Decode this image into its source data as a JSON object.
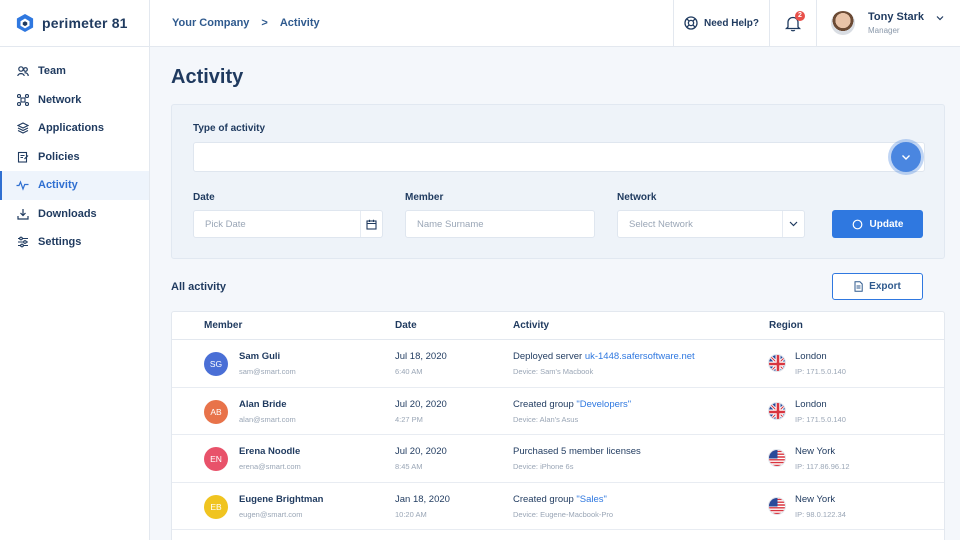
{
  "app": {
    "logo_text": "perimeter 81"
  },
  "sidebar": {
    "items": [
      {
        "label": "Team",
        "icon": "team-icon",
        "active": false
      },
      {
        "label": "Network",
        "icon": "network-icon",
        "active": false
      },
      {
        "label": "Applications",
        "icon": "applications-icon",
        "active": false
      },
      {
        "label": "Policies",
        "icon": "policies-icon",
        "active": false
      },
      {
        "label": "Activity",
        "icon": "activity-icon",
        "active": true
      },
      {
        "label": "Downloads",
        "icon": "downloads-icon",
        "active": false
      },
      {
        "label": "Settings",
        "icon": "settings-icon",
        "active": false
      }
    ]
  },
  "header": {
    "breadcrumb": [
      "Your Company",
      "Activity"
    ],
    "breadcrumb_separator": ">",
    "help_label": "Need Help?",
    "notification_count": "2",
    "user_name": "Tony Stark",
    "user_role": "Manager"
  },
  "page": {
    "title": "Activity"
  },
  "filters": {
    "type_label": "Type of activity",
    "type_value": "",
    "date_label": "Date",
    "date_placeholder": "Pick Date",
    "member_label": "Member",
    "member_placeholder": "Name Surname",
    "network_label": "Network",
    "network_placeholder": "Select Network",
    "update_label": "Update"
  },
  "activity": {
    "section_title": "All activity",
    "export_label": "Export",
    "columns": [
      "Member",
      "Date",
      "Activity",
      "Region"
    ],
    "rows": [
      {
        "initials": "SG",
        "avatar_color": "#4a6fd6",
        "name": "Sam Guli",
        "email": "sam@smart.com",
        "date": "Jul 18, 2020",
        "time": "6:40 AM",
        "activity_text": "Deployed server ",
        "activity_link": "uk-1448.safersoftware.net",
        "device": "Device: Sam's Macbook",
        "flag": "uk",
        "city": "London",
        "ip": "IP: 171.5.0.140"
      },
      {
        "initials": "AB",
        "avatar_color": "#e8734a",
        "name": "Alan Bride",
        "email": "alan@smart.com",
        "date": "Jul 20, 2020",
        "time": "4:27 PM",
        "activity_text": "Created group ",
        "activity_link": "\"Developers\"",
        "device": "Device: Alan's Asus",
        "flag": "uk",
        "city": "London",
        "ip": "IP: 171.5.0.140"
      },
      {
        "initials": "EN",
        "avatar_color": "#e8526a",
        "name": "Erena Noodle",
        "email": "erena@smart.com",
        "date": "Jul 20, 2020",
        "time": "8:45 AM",
        "activity_text": "Purchased 5 member licenses",
        "activity_link": "",
        "device": "Device: iPhone 6s",
        "flag": "us",
        "city": "New York",
        "ip": "IP: 117.86.96.12"
      },
      {
        "initials": "EB",
        "avatar_color": "#f0c420",
        "name": "Eugene Brightman",
        "email": "eugen@smart.com",
        "date": "Jan 18, 2020",
        "time": "10:20 AM",
        "activity_text": "Created group ",
        "activity_link": "\"Sales\"",
        "device": "Device: Eugene-Macbook-Pro",
        "flag": "us",
        "city": "New York",
        "ip": "IP: 98.0.122.34"
      }
    ]
  },
  "colors": {
    "accent": "#2f78e0",
    "text": "#1f3a5f",
    "muted": "#9aa6b6"
  }
}
